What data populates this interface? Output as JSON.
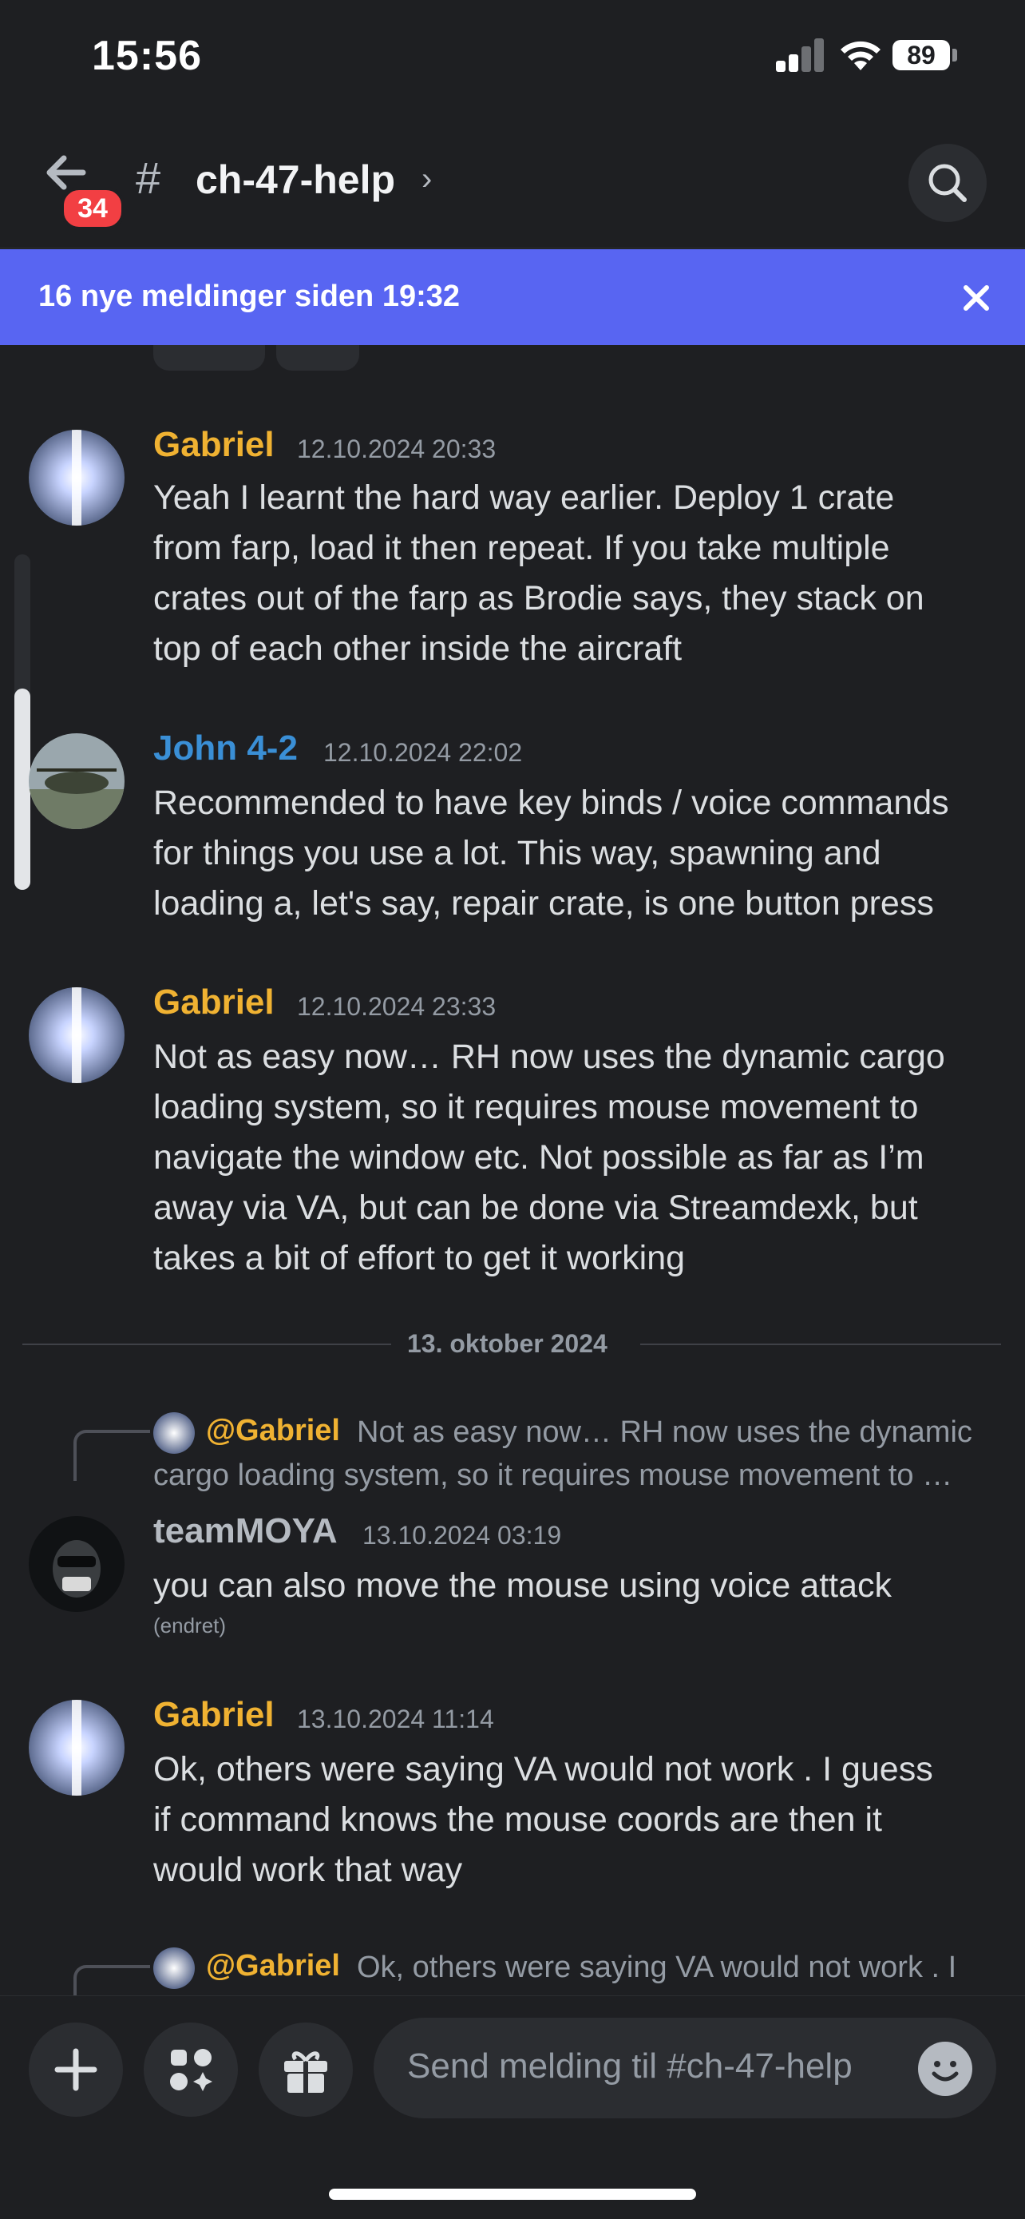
{
  "status_bar": {
    "time": "15:56",
    "battery": "89"
  },
  "header": {
    "unread_count": "34",
    "channel_hash": "#",
    "channel_name": "ch-47-help",
    "chevron": "›"
  },
  "new_messages_banner": {
    "text": "16 nye meldinger siden 19:32"
  },
  "messages": [
    {
      "author": "Gabriel",
      "timestamp": "12.10.2024 20:33",
      "lines": [
        "Yeah I learnt the hard way earlier.  Deploy 1 crate",
        "from farp, load it then repeat.   If you take multiple",
        "crates out of the farp as Brodie says, they stack on",
        "top of each other inside the aircraft"
      ]
    },
    {
      "author": "John 4-2",
      "timestamp": "12.10.2024 22:02",
      "lines": [
        "Recommended to have key binds / voice commands",
        "for things you use a lot. This way, spawning and",
        "loading a, let's say, repair crate, is one button press"
      ]
    },
    {
      "author": "Gabriel",
      "timestamp": "12.10.2024 23:33",
      "lines": [
        "Not as easy now… RH now uses the dynamic cargo",
        "loading system, so it requires mouse movement to",
        "navigate the window etc.  Not possible as far as I’m",
        "away via VA, but can be done via Streamdexk, but",
        "takes a bit of effort to get it working"
      ]
    },
    {
      "reply_mention": "@Gabriel",
      "reply_line1": "Not as easy now… RH now uses the dynamic",
      "reply_line2": "cargo loading system, so it requires mouse movement to …",
      "author": "teamMOYA",
      "timestamp": "13.10.2024 03:19",
      "lines": [
        "you can also move the mouse using voice attack"
      ],
      "edited": "(endret)"
    },
    {
      "author": "Gabriel",
      "timestamp": "13.10.2024 11:14",
      "lines": [
        "Ok, others were saying VA would not work .  I guess",
        "if command knows the mouse coords  are then it",
        "would work that way"
      ]
    },
    {
      "reply_mention": "@Gabriel",
      "reply_line1": "Ok, others were saying VA would not work .  I"
    }
  ],
  "date_divider": "13. oktober 2024",
  "composer": {
    "placeholder": "Send melding til #ch-47-help"
  },
  "colors": {
    "background": "#1e1f22",
    "banner": "#5865f2",
    "gabriel": "#f0b232",
    "john": "#3a8fd6",
    "teammoya": "#b5bac1",
    "badge": "#f23f43"
  },
  "icons": [
    "back-arrow-icon",
    "hash-icon",
    "chevron-right-icon",
    "search-icon",
    "close-icon",
    "plus-icon",
    "apps-icon",
    "gift-icon",
    "emoji-icon"
  ]
}
